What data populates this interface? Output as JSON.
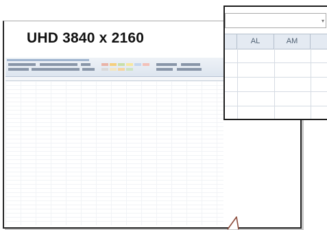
{
  "caption": {
    "resolution": "UHD 3840 x 2160"
  },
  "zoom_inset": {
    "column_headers": [
      "AL",
      "AM"
    ]
  },
  "colors": {
    "bezel": "#262626",
    "header_fill": "#e4eaf2",
    "header_text": "#4f6072",
    "pointer": "#8b4a3a"
  },
  "icons": [
    "dropdown-caret-icon",
    "callout-pointer-icon"
  ]
}
